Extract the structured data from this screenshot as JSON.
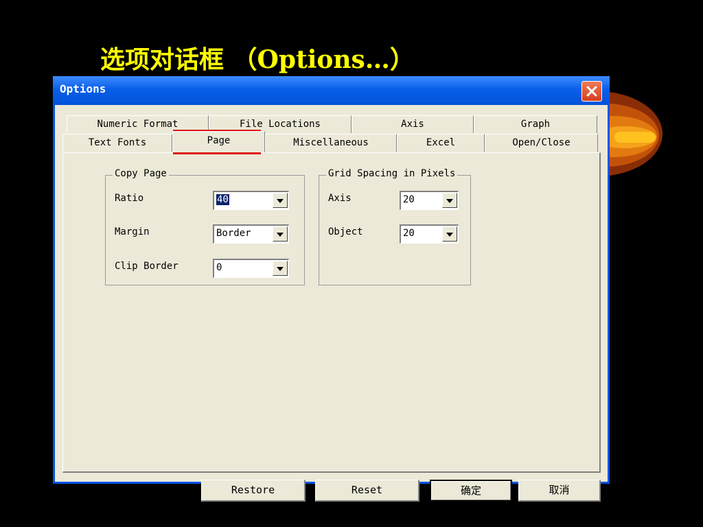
{
  "slide": {
    "title": "选项对话框 （Options…）"
  },
  "dialog": {
    "title": "Options",
    "close_icon": "close-icon",
    "tabs_row1": [
      "Numeric Format",
      "File Locations",
      "Axis",
      "Graph"
    ],
    "tabs_row2": [
      "Text Fonts",
      "Page",
      "Miscellaneous",
      "Excel",
      "Open/Close"
    ],
    "active_tab": "Page",
    "copy_page": {
      "legend": "Copy Page",
      "ratio_label": "Ratio",
      "ratio_value": "40",
      "margin_label": "Margin",
      "margin_value": "Border",
      "clip_border_label": "Clip Border",
      "clip_border_value": "0"
    },
    "grid_spacing": {
      "legend": "Grid Spacing in Pixels",
      "axis_label": "Axis",
      "axis_value": "20",
      "object_label": "Object",
      "object_value": "20"
    },
    "buttons": {
      "restore": "Restore",
      "reset": "Reset",
      "ok": "确定",
      "cancel": "取消"
    }
  },
  "colors": {
    "title_yellow": "#ffff00",
    "titlebar_blue": "#0a5fe8",
    "dialog_bg": "#ece9d8",
    "highlight_red": "#e01010"
  }
}
